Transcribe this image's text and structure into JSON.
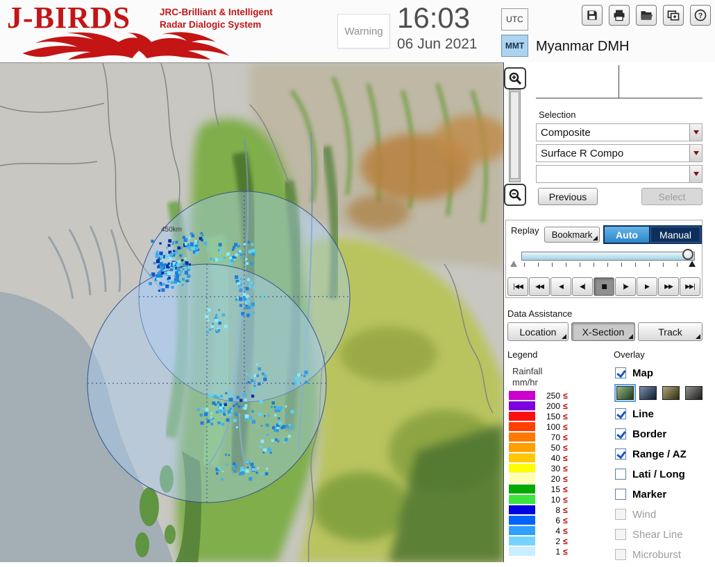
{
  "header": {
    "logo": {
      "title": "J-BIRDS",
      "subtitle1": "JRC-Brilliant & Intelligent",
      "subtitle2": "Radar  Dialogic  System"
    },
    "warning_label": "Warning",
    "clock": {
      "time": "16:03",
      "date": "06 Jun 2021",
      "tz_utc": "UTC",
      "tz_mmt": "MMT",
      "tz_selected": "MMT"
    },
    "org_name": "Myanmar DMH",
    "toolbar_icons": [
      "save-icon",
      "print-icon",
      "open-folder-icon",
      "add-window-icon",
      "help-icon"
    ]
  },
  "map": {
    "range_label": "450km"
  },
  "selection": {
    "label": "Selection",
    "combo_composite": "Composite",
    "combo_product": "Surface R Compo",
    "combo_extra": "",
    "previous_label": "Previous",
    "select_label": "Select"
  },
  "replay": {
    "label": "Replay",
    "bookmark_label": "Bookmark",
    "auto_label": "Auto",
    "manual_label": "Manual",
    "playback_buttons": [
      "|◀◀",
      "◀◀",
      "◀",
      "◀|",
      "■",
      "|▶",
      "▶",
      "▶▶",
      "▶▶|"
    ]
  },
  "data_assistance": {
    "label": "Data Assistance",
    "location": "Location",
    "xsection": "X-Section",
    "track": "Track"
  },
  "legend": {
    "label": "Legend",
    "unit_title": "Rainfall",
    "unit": "mm/hr",
    "leq": "≤",
    "rows": [
      {
        "value": "250",
        "color": "#cc00cc"
      },
      {
        "value": "200",
        "color": "#7d00e0"
      },
      {
        "value": "150",
        "color": "#ff1010"
      },
      {
        "value": "100",
        "color": "#ff4000"
      },
      {
        "value": "70",
        "color": "#ff7800"
      },
      {
        "value": "50",
        "color": "#ffa000"
      },
      {
        "value": "40",
        "color": "#ffc800"
      },
      {
        "value": "30",
        "color": "#ffff00"
      },
      {
        "value": "20",
        "color": "#ffffb0"
      },
      {
        "value": "15",
        "color": "#00aa00"
      },
      {
        "value": "10",
        "color": "#3ce43c"
      },
      {
        "value": "8",
        "color": "#0000e0"
      },
      {
        "value": "6",
        "color": "#0064ff"
      },
      {
        "value": "4",
        "color": "#30a0ff"
      },
      {
        "value": "2",
        "color": "#78d2ff"
      },
      {
        "value": "1",
        "color": "#c8eeff"
      }
    ]
  },
  "overlay": {
    "label": "Overlay",
    "swatch_colors": [
      "#3f7d2f",
      "#16356b",
      "#6b5d14",
      "#3a3a38"
    ],
    "selected_swatch": 0,
    "items": [
      {
        "label": "Map",
        "checked": true,
        "enabled": true
      },
      {
        "label": "Line",
        "checked": true,
        "enabled": true
      },
      {
        "label": "Border",
        "checked": true,
        "enabled": true
      },
      {
        "label": "Range / AZ",
        "checked": true,
        "enabled": true
      },
      {
        "label": "Lati / Long",
        "checked": false,
        "enabled": true
      },
      {
        "label": "Marker",
        "checked": false,
        "enabled": true
      },
      {
        "label": "Wind",
        "checked": false,
        "enabled": false
      },
      {
        "label": "Shear Line",
        "checked": false,
        "enabled": false
      },
      {
        "label": "Microburst",
        "checked": false,
        "enabled": false
      }
    ]
  }
}
